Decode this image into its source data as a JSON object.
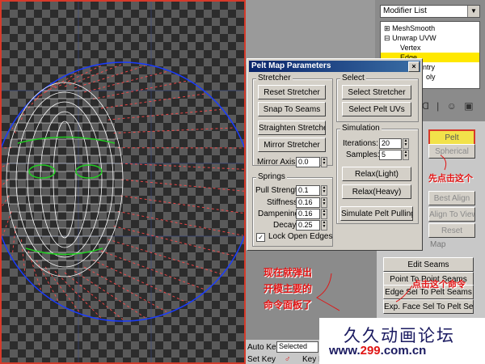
{
  "modifier_panel": {
    "modifier_list_label": "Modifier List",
    "stack": [
      {
        "label": "MeshSmooth",
        "prefix": "+"
      },
      {
        "label": "Unwrap UVW",
        "prefix": "-"
      },
      {
        "label": "Vertex",
        "prefix": ""
      },
      {
        "label": "Edge",
        "prefix": "",
        "selected": true
      },
      {
        "label": "ntry",
        "prefix": ""
      },
      {
        "label": "oly",
        "prefix": ""
      }
    ]
  },
  "side_buttons": {
    "pelt": "Pelt",
    "spherical": "Spherical",
    "best_align": "Best Align",
    "align_to_view": "Align To View",
    "reset": "Reset",
    "map_label": "Map",
    "edit_seams": "Edit Seams",
    "point_to_point_seams": "Point To Point Seams",
    "edge_sel_to_pelt_seams": "Edge Sel To Pelt Seams",
    "exp_face_sel_to_pelt_seams": "Exp. Face Sel To Pelt Seams"
  },
  "dialog": {
    "title": "Pelt Map Parameters",
    "close": "×",
    "stretcher_group": "Stretcher",
    "reset_stretcher": "Reset Stretcher",
    "snap_to_seams": "Snap To Seams",
    "straighten_stretcher": "Straighten Stretcher",
    "mirror_stretcher": "Mirror Stretcher",
    "mirror_axis_label": "Mirror Axis:",
    "mirror_axis_value": "0.0",
    "springs_group": "Springs",
    "pull_strength_label": "Pull Strength:",
    "pull_strength_value": "0.1",
    "stiffness_label": "Stiffness:",
    "stiffness_value": "0.16",
    "dampening_label": "Dampening:",
    "dampening_value": "0.16",
    "decay_label": "Decay:",
    "decay_value": "0.25",
    "lock_open_edges_label": "Lock Open Edges",
    "lock_open_edges_checked": true,
    "select_group": "Select",
    "select_stretcher": "Select Stretcher",
    "select_pelt_uvs": "Select Pelt UVs",
    "simulation_group": "Simulation",
    "iterations_label": "Iterations:",
    "iterations_value": "20",
    "samples_label": "Samples:",
    "samples_value": "5",
    "relax_light": "Relax(Light)",
    "relax_heavy": "Relax(Heavy)",
    "simulate_pelt_pulling": "Simulate Pelt Pulling"
  },
  "annotations": {
    "click_first": "先点击这个",
    "popup_note_line1": "现在就弹出",
    "popup_note_line2": "开模主要的",
    "popup_note_line3": "命令面板了",
    "click_this_cmd": "点击这个命令"
  },
  "bottom": {
    "auto_key": "Auto Key",
    "set_key": "Set Key",
    "selected": "Selected",
    "key_filters": "Key Filters..."
  },
  "watermark": {
    "name": "久久动画论坛",
    "url_prefix": "www.",
    "url_number": "299",
    "url_suffix": ".com.cn"
  },
  "colors": {
    "annotation_red": "#e01515",
    "selection_yellow": "#ffe800",
    "wire_white": "#ffffff",
    "seam_green": "#22cc22",
    "circle_blue": "#1a3cff",
    "stretch_red": "#ff4040"
  }
}
